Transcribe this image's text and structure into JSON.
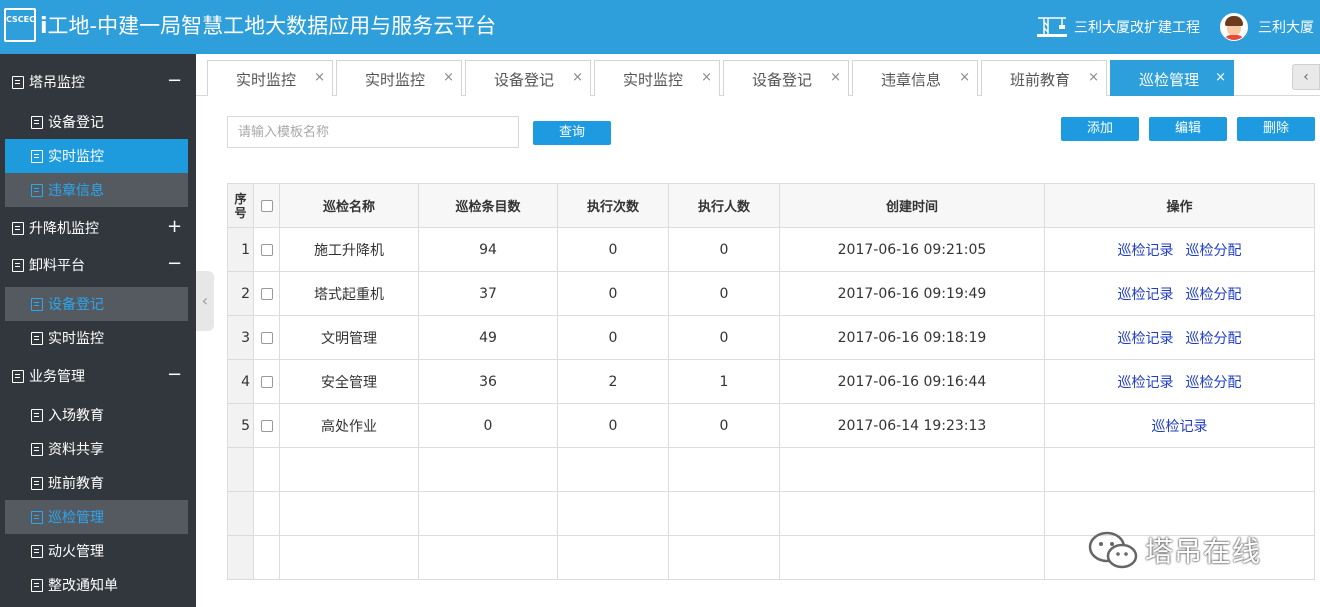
{
  "header": {
    "logo_text": "CSCEC",
    "title_prefix": "i",
    "title_rest": "工地-中建一局智慧工地大数据应用与服务云平台",
    "project_name": "三利大厦改扩建工程",
    "user_name": "三利大厦"
  },
  "sidebar": {
    "groups": [
      {
        "label": "塔吊监控",
        "toggle": "−"
      },
      {
        "label": "升降机监控",
        "toggle": "+"
      },
      {
        "label": "卸料平台",
        "toggle": "−"
      },
      {
        "label": "业务管理",
        "toggle": "−"
      }
    ],
    "items": [
      {
        "label": "设备登记"
      },
      {
        "label": "实时监控"
      },
      {
        "label": "违章信息"
      },
      {
        "label": "设备登记"
      },
      {
        "label": "实时监控"
      },
      {
        "label": "入场教育"
      },
      {
        "label": "资料共享"
      },
      {
        "label": "班前教育"
      },
      {
        "label": "巡检管理"
      },
      {
        "label": "动火管理"
      },
      {
        "label": "整改通知单"
      }
    ],
    "collapse_icon": "chevron-left-icon"
  },
  "tabs": [
    {
      "label": "实时监控",
      "close": "×"
    },
    {
      "label": "实时监控",
      "close": "×"
    },
    {
      "label": "设备登记",
      "close": "×"
    },
    {
      "label": "实时监控",
      "close": "×"
    },
    {
      "label": "设备登记",
      "close": "×"
    },
    {
      "label": "违章信息",
      "close": "×"
    },
    {
      "label": "班前教育",
      "close": "×"
    },
    {
      "label": "巡检管理",
      "close": "×"
    }
  ],
  "toolbar": {
    "search_placeholder": "请输入模板名称",
    "query_label": "查询",
    "add_label": "添加",
    "edit_label": "编辑",
    "delete_label": "删除"
  },
  "table": {
    "headers": {
      "seq": "序号",
      "name": "巡检名称",
      "items": "巡检条目数",
      "exec_count": "执行次数",
      "exec_people": "执行人数",
      "created": "创建时间",
      "ops": "操作"
    },
    "rows": [
      {
        "seq": "1",
        "name": "施工升降机",
        "items": "94",
        "exec_count": "0",
        "exec_people": "0",
        "created": "2017-06-16 09:21:05",
        "op1": "巡检记录",
        "op2": "巡检分配"
      },
      {
        "seq": "2",
        "name": "塔式起重机",
        "items": "37",
        "exec_count": "0",
        "exec_people": "0",
        "created": "2017-06-16 09:19:49",
        "op1": "巡检记录",
        "op2": "巡检分配"
      },
      {
        "seq": "3",
        "name": "文明管理",
        "items": "49",
        "exec_count": "0",
        "exec_people": "0",
        "created": "2017-06-16 09:18:19",
        "op1": "巡检记录",
        "op2": "巡检分配"
      },
      {
        "seq": "4",
        "name": "安全管理",
        "items": "36",
        "exec_count": "2",
        "exec_people": "1",
        "created": "2017-06-16 09:16:44",
        "op1": "巡检记录",
        "op2": "巡检分配"
      },
      {
        "seq": "5",
        "name": "高处作业",
        "items": "0",
        "exec_count": "0",
        "exec_people": "0",
        "created": "2017-06-14 19:23:13",
        "op1": "巡检记录",
        "op2": ""
      }
    ]
  },
  "watermark": {
    "text": "塔吊在线",
    "icon": "wechat-icon"
  },
  "colors": {
    "header_bg": "#2f9fdc",
    "sidebar_bg": "#32373d",
    "active": "#1e9bdc",
    "link": "#1f3dc8"
  }
}
